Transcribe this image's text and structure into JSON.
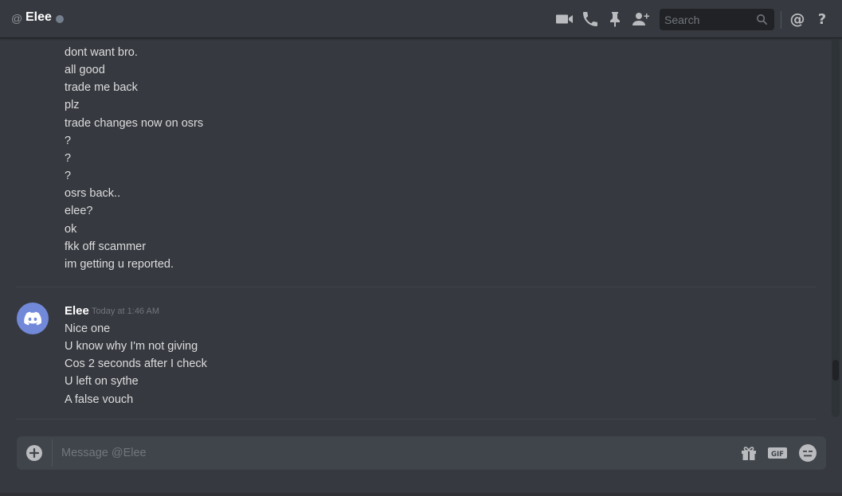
{
  "header": {
    "at_symbol": "@",
    "title": "Elee",
    "search_placeholder": "Search",
    "icons": [
      "video-call-icon",
      "voice-call-icon",
      "pinned-messages-icon",
      "add-friend-icon",
      "search-icon",
      "mentions-icon",
      "help-icon"
    ]
  },
  "messages": {
    "previous_group": {
      "lines": [
        "dont want bro.",
        "all good",
        "trade me back",
        "plz",
        "trade changes now on osrs",
        "?",
        "?",
        "?",
        "osrs back..",
        "elee?",
        "ok",
        "fkk off scammer",
        "im getting u reported."
      ]
    },
    "elee_group": {
      "username": "Elee",
      "timestamp": "Today at 1:46 AM",
      "lines": [
        "Nice one",
        "U know why I'm not giving",
        "Cos 2 seconds after I check",
        "U left on sythe",
        "A false vouch"
      ]
    }
  },
  "composer": {
    "placeholder": "Message @Elee",
    "icons": [
      "attach-plus-icon",
      "gift-icon",
      "gif-icon",
      "emoji-icon"
    ],
    "gif_label": "GIF"
  },
  "colors": {
    "background": "#36393f",
    "accent": "#7289da",
    "input_bg": "#40444b",
    "status_offline": "#747f8d"
  }
}
